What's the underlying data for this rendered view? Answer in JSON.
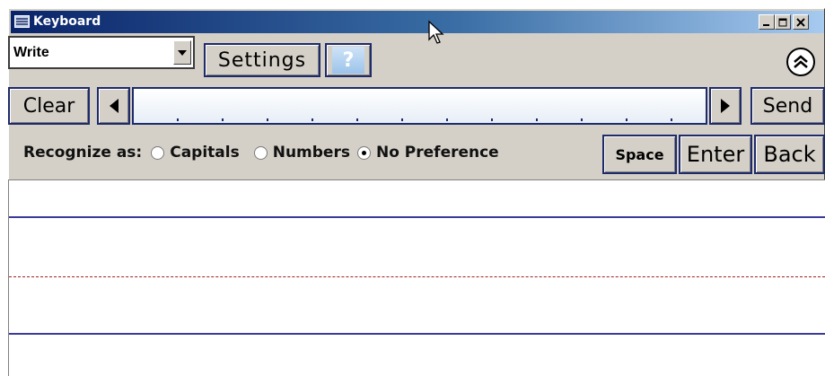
{
  "window": {
    "title": "Keyboard",
    "title_icon": "keyboard-icon",
    "controls": [
      "minimize-icon",
      "maximize-icon",
      "close-icon"
    ]
  },
  "toolbar": {
    "mode_value": "Write",
    "settings_label": "Settings",
    "help_label": "?",
    "collapse_icon": "double-chevron-up-icon"
  },
  "text_row": {
    "clear_label": "Clear",
    "send_label": "Send",
    "content": ""
  },
  "recognize": {
    "label": "Recognize as:",
    "options": [
      {
        "label": "Capitals",
        "checked": false
      },
      {
        "label": "Numbers",
        "checked": false
      },
      {
        "label": "No Preference",
        "checked": true
      }
    ]
  },
  "keys": {
    "space_label": "Space",
    "enter_label": "Enter",
    "back_label": "Back"
  },
  "colors": {
    "title_start": "#0a246a",
    "title_end": "#a6caf0",
    "button_border": "#1e2a6a",
    "guide_line": "#3a3a9a",
    "mid_line": "#a02020"
  }
}
